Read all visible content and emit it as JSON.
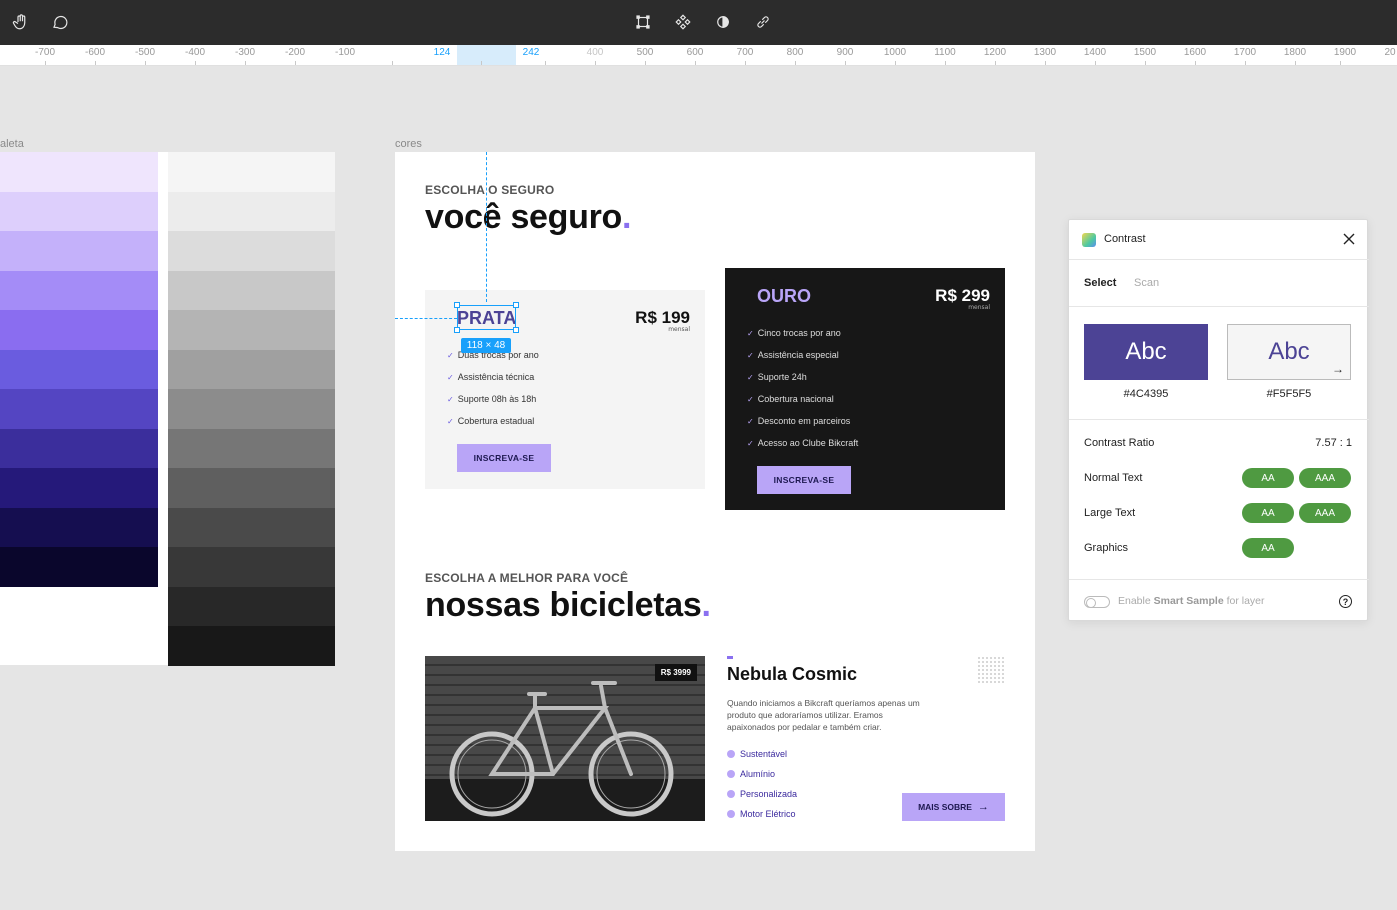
{
  "toolbar": {
    "left_icons": [
      "hand-tool-icon",
      "comment-icon"
    ],
    "center_icons": [
      "frame-icon",
      "component-icon",
      "contrast-icon",
      "link-icon"
    ]
  },
  "ruler": {
    "labels": [
      "-700",
      "-600",
      "-500",
      "-400",
      "-300",
      "-200",
      "-100",
      "124",
      "242",
      "400",
      "500",
      "600",
      "700",
      "800",
      "900",
      "1000",
      "1100",
      "1200",
      "1300",
      "1400",
      "1500",
      "1600",
      "1700",
      "1800",
      "1900",
      "20"
    ],
    "highlighted": [
      "124",
      "242"
    ],
    "muted": [
      "400"
    ]
  },
  "frames": {
    "palette_label": "aleta",
    "cores_label": "cores"
  },
  "palette": {
    "purple": [
      "#efe5fd",
      "#ddcffc",
      "#c4b1fa",
      "#a48cf7",
      "#8a6df0",
      "#6a5cdf",
      "#5445c2",
      "#3b2e9c",
      "#25197a",
      "#150e50",
      "#0a062c"
    ],
    "gray": [
      "#f5f5f5",
      "#ececec",
      "#dcdcdc",
      "#c8c8c8",
      "#b4b4b4",
      "#a0a0a0",
      "#8c8c8c",
      "#767676",
      "#5f5f5f",
      "#4a4a4a",
      "#383838",
      "#282828",
      "#181818"
    ]
  },
  "cores": {
    "section1": {
      "eyebrow": "ESCOLHA O SEGURO",
      "headline": "você seguro",
      "headline_dot": "."
    },
    "prata": {
      "name": "PRATA",
      "price": "R$ 199",
      "period": "mensal",
      "features": [
        "Duas trocas por ano",
        "Assistência técnica",
        "Suporte 08h às 18h",
        "Cobertura estadual"
      ],
      "button": "INSCREVA-SE"
    },
    "ouro": {
      "name": "OURO",
      "price": "R$ 299",
      "period": "mensal",
      "features": [
        "Cinco trocas por ano",
        "Assistência especial",
        "Suporte 24h",
        "Cobertura nacional",
        "Desconto em parceiros",
        "Acesso ao Clube Bikcraft"
      ],
      "button": "INSCREVA-SE"
    },
    "selection": {
      "dimensions": "118 × 48"
    },
    "section2": {
      "eyebrow": "ESCOLHA A MELHOR PARA VOCÊ",
      "headline": "nossas bicicletas",
      "headline_dot": "."
    },
    "bike": {
      "price_tag": "R$ 3999",
      "title": "Nebula Cosmic",
      "description": "Quando iniciamos a Bikcraft queríamos apenas um produto que adoraríamos utilizar. Eramos apaixonados por pedalar e também criar.",
      "features": [
        "Sustentável",
        "Alumínio",
        "Personalizada",
        "Motor Elétrico"
      ],
      "button": "MAIS SOBRE"
    }
  },
  "contrast_panel": {
    "title": "Contrast",
    "tabs": [
      "Select",
      "Scan"
    ],
    "active_tab": "Select",
    "foreground": {
      "sample": "Abc",
      "hex": "#4C4395",
      "bg": "#4C4395",
      "fg": "#ffffff"
    },
    "background": {
      "sample": "Abc",
      "hex": "#F5F5F5",
      "bg": "#F5F5F5",
      "fg": "#4C4395"
    },
    "ratio_label": "Contrast Ratio",
    "ratio_value": "7.57 : 1",
    "rows": [
      {
        "label": "Normal Text",
        "badges": [
          "AA",
          "AAA"
        ]
      },
      {
        "label": "Large Text",
        "badges": [
          "AA",
          "AAA"
        ]
      },
      {
        "label": "Graphics",
        "badges": [
          "AA"
        ]
      }
    ],
    "footer_pre": "Enable",
    "footer_bold": "Smart Sample",
    "footer_post": "for layer",
    "help": "?"
  }
}
